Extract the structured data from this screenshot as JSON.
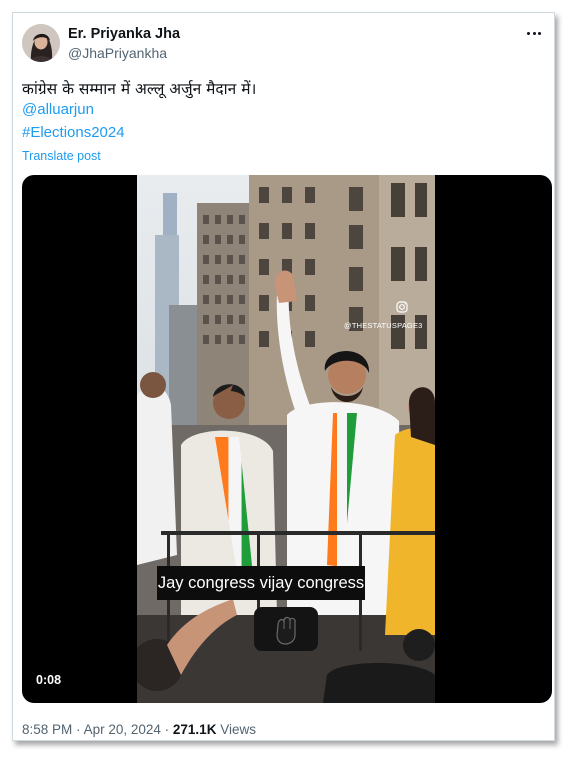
{
  "author": {
    "name": "Er. Priyanka Jha",
    "handle": "@JhaPriyankha"
  },
  "tweet": {
    "text": "कांग्रेस के सम्मान में अल्लू अर्जुन मैदान में।",
    "mention": "@alluarjun",
    "hashtag": "#Elections2024",
    "translate_label": "Translate post"
  },
  "video": {
    "caption": "Jay congress vijay congress",
    "watermark": "@THESTATUSPAGE3",
    "duration": "0:08"
  },
  "meta": {
    "time": "8:58 PM",
    "separator": "·",
    "date": "Apr 20, 2024",
    "views_count": "271.1K",
    "views_label": "Views"
  },
  "colors": {
    "link": "#1d9bf0",
    "secondary_text": "#536471",
    "primary_text": "#0f1419"
  }
}
